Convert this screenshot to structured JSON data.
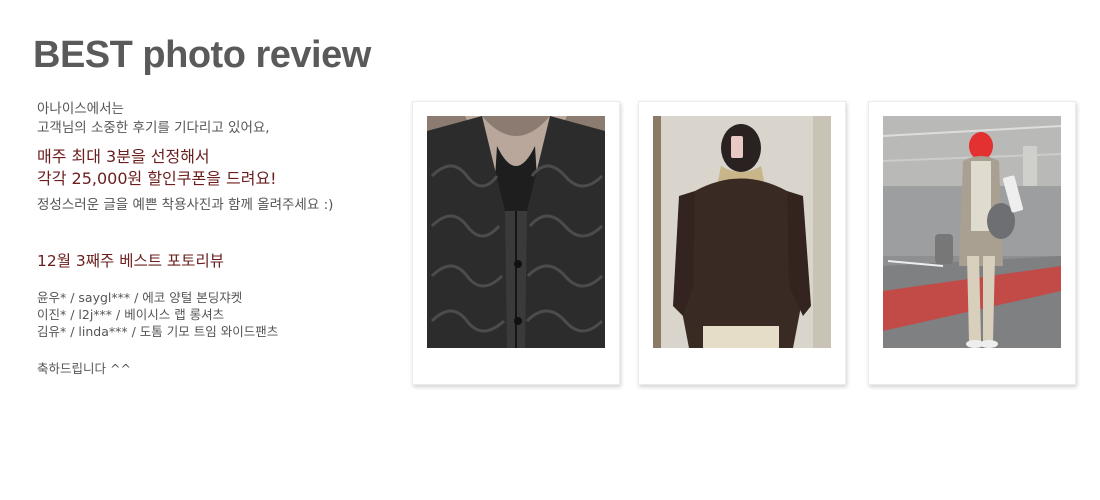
{
  "header": {
    "title": "BEST photo review"
  },
  "intro": {
    "line1": "아나이스에서는",
    "line2": "고객님의 소중한 후기를 기다리고 있어요,"
  },
  "highlight": {
    "line1": "매주 최대 3분을 선정해서",
    "line2": "각각 25,000원 할인쿠폰을 드려요!"
  },
  "note": "정성스러운 글을 예쁜 착용사진과 함께 올려주세요 :)",
  "week_title": "12월 3째주 베스트 포토리뷰",
  "winners": [
    "윤우* / saygl*** / 에코 양털 본딩쟈켓",
    "이진* / l2j*** / 베이시스 랩 롱셔츠",
    "김유* / linda*** / 도톰 기모 트임 와이드팬츠"
  ],
  "congrats": "축하드립니다 ^^",
  "photos": [
    {
      "icon": "quilted-jacket-photo"
    },
    {
      "icon": "mirror-selfie-shirt-photo"
    },
    {
      "icon": "parking-garage-outfit-photo"
    }
  ],
  "colors": {
    "accent": "#6b1e1e",
    "title": "#5a5a5a",
    "text": "#555555"
  }
}
